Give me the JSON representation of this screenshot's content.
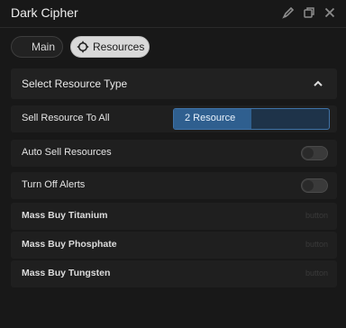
{
  "window": {
    "title": "Dark Cipher",
    "icons": [
      "pencil-icon",
      "restore-icon",
      "close-icon"
    ]
  },
  "tabs": [
    {
      "label": "Main",
      "active": false
    },
    {
      "label": "Resources",
      "active": true,
      "icon": "target-icon"
    }
  ],
  "section": {
    "title": "Select Resource Type",
    "icon": "chevron-up-icon",
    "expanded": true
  },
  "rows": {
    "sell_all": {
      "label": "Sell Resource To All",
      "dropdown_value": "2 Resource"
    },
    "auto_sell": {
      "label": "Auto Sell Resources",
      "toggle_on": false
    },
    "alerts_off": {
      "label": "Turn Off Alerts",
      "toggle_on": false
    },
    "buy_titanium": {
      "label": "Mass Buy Titanium",
      "button_label": "button"
    },
    "buy_phosphate": {
      "label": "Mass Buy Phosphate",
      "button_label": "button"
    },
    "buy_tungsten": {
      "label": "Mass Buy Tungsten",
      "button_label": "button"
    }
  },
  "colors": {
    "background": "#181818",
    "row": "#1f1f1f",
    "accent": "#2f5f8f",
    "accent_border": "#3f73a8"
  }
}
